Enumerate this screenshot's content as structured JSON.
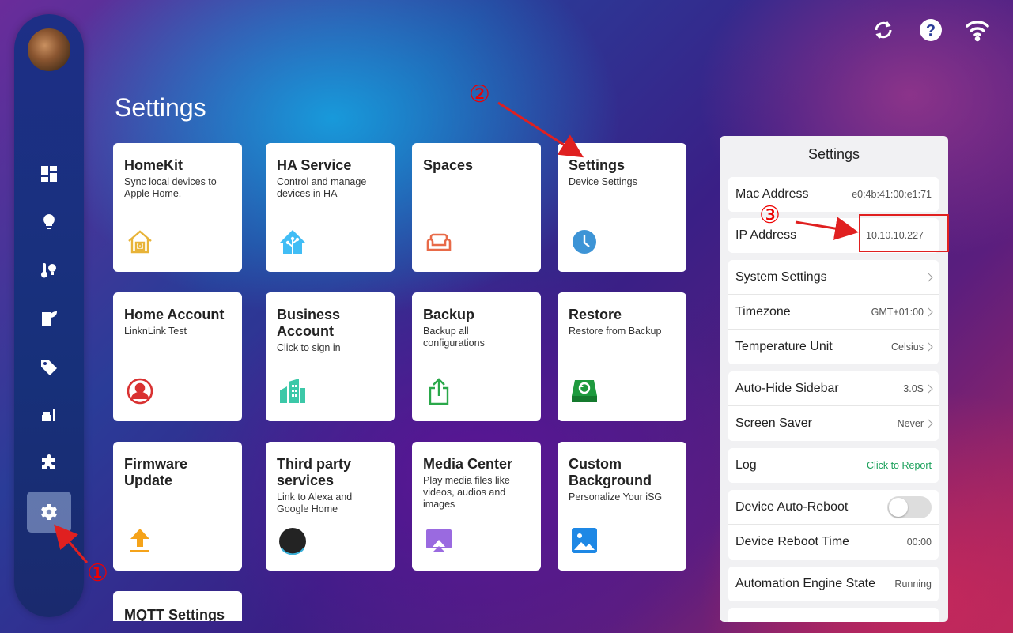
{
  "sidebar": {
    "items": [
      {
        "name": "dashboard-icon"
      },
      {
        "name": "lightbulb-icon"
      },
      {
        "name": "climate-icon"
      },
      {
        "name": "energy-icon"
      },
      {
        "name": "tag-icon"
      },
      {
        "name": "scene-icon"
      },
      {
        "name": "puzzle-icon"
      },
      {
        "name": "gear-icon",
        "active": true
      }
    ]
  },
  "topbar": {
    "icons": [
      "sync-icon",
      "help-icon",
      "wifi-icon"
    ]
  },
  "page": {
    "title": "Settings"
  },
  "cards": [
    {
      "title": "HomeKit",
      "subtitle": "Sync local devices to Apple Home.",
      "icon": "homekit-icon"
    },
    {
      "title": "HA Service",
      "subtitle": "Control and manage devices in HA",
      "icon": "ha-icon"
    },
    {
      "title": "Spaces",
      "subtitle": "",
      "icon": "sofa-icon"
    },
    {
      "title": "Settings",
      "subtitle": "Device Settings",
      "icon": "clock-icon"
    },
    {
      "title": "Home Account",
      "subtitle": "LinknLink Test",
      "icon": "user-icon"
    },
    {
      "title": "Business Account",
      "subtitle": "Click to sign in",
      "icon": "building-icon"
    },
    {
      "title": "Backup",
      "subtitle": "Backup all configurations",
      "icon": "share-icon"
    },
    {
      "title": "Restore",
      "subtitle": "Restore from Backup",
      "icon": "restore-icon"
    },
    {
      "title": "Firmware Update",
      "subtitle": "",
      "icon": "upload-icon"
    },
    {
      "title": "Third party services",
      "subtitle": "Link to Alexa and Google Home",
      "icon": "echo-icon"
    },
    {
      "title": "Media Center",
      "subtitle": "Play media files like videos, audios and images",
      "icon": "media-icon"
    },
    {
      "title": "Custom Background",
      "subtitle": "Personalize Your iSG",
      "icon": "image-icon"
    },
    {
      "title": "MQTT Settings",
      "subtitle": "",
      "icon": ""
    }
  ],
  "panel": {
    "title": "Settings",
    "mac": {
      "label": "Mac Address",
      "value": "e0:4b:41:00:e1:71"
    },
    "ip": {
      "label": "IP Address",
      "value": "10.10.10.227"
    },
    "system": {
      "label": "System Settings"
    },
    "timezone": {
      "label": "Timezone",
      "value": "GMT+01:00"
    },
    "temp": {
      "label": "Temperature Unit",
      "value": "Celsius"
    },
    "autohide": {
      "label": "Auto-Hide Sidebar",
      "value": "3.0S"
    },
    "saver": {
      "label": "Screen Saver",
      "value": "Never"
    },
    "log": {
      "label": "Log",
      "value": "Click to Report"
    },
    "autoreboot": {
      "label": "Device Auto-Reboot",
      "on": false
    },
    "reboottime": {
      "label": "Device Reboot Time",
      "value": "00:00"
    },
    "engine": {
      "label": "Automation Engine State",
      "value": "Running"
    }
  },
  "annotations": {
    "one": "①",
    "two": "②",
    "three": "③"
  },
  "colors": {
    "accent_green": "#1aa05a",
    "annotation_red": "#e02020"
  }
}
